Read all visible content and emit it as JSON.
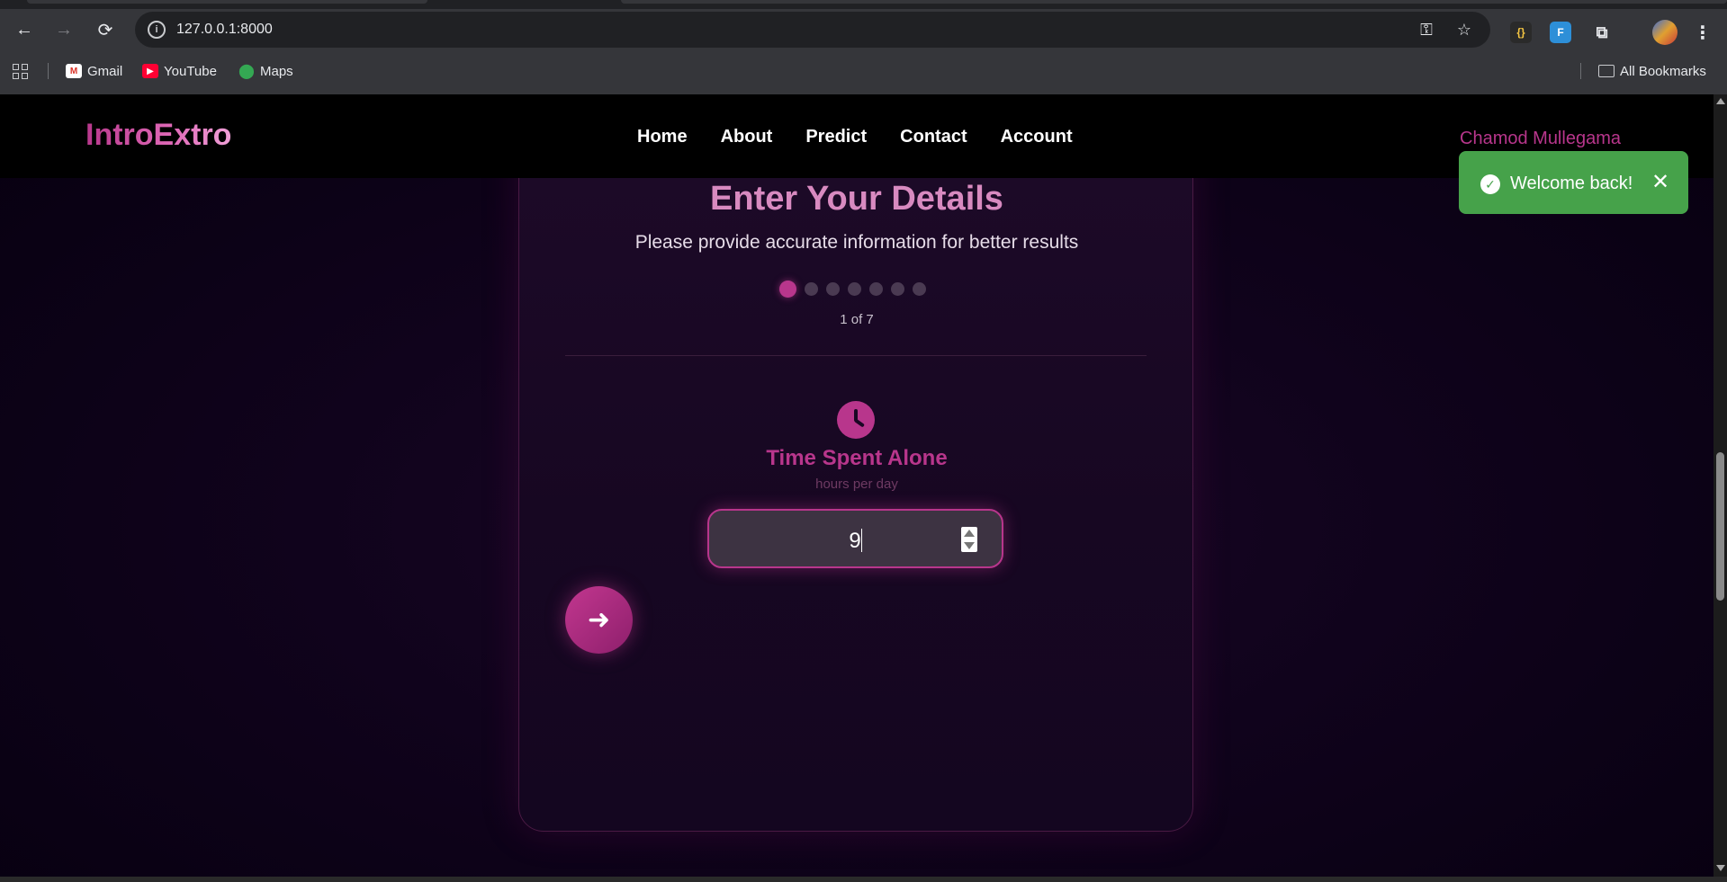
{
  "browser": {
    "url": "127.0.0.1:8000",
    "bookmarks": [
      {
        "label": "Gmail",
        "icon": "gmail-icon"
      },
      {
        "label": "YouTube",
        "icon": "youtube-icon"
      },
      {
        "label": "Maps",
        "icon": "maps-icon"
      }
    ],
    "all_bookmarks_label": "All Bookmarks"
  },
  "site": {
    "logo": "IntroExtro",
    "nav": [
      "Home",
      "About",
      "Predict",
      "Contact",
      "Account"
    ],
    "user_name": "Chamod Mullegama"
  },
  "form": {
    "title": "Enter Your Details",
    "subtitle": "Please provide accurate information for better results",
    "step_text": "1 of 7",
    "total_steps": 7,
    "current_step": 1,
    "field_label": "Time Spent Alone",
    "field_hint": "hours per day",
    "field_value": "9",
    "field_icon": "clock-icon",
    "next_icon": "arrow-right-icon"
  },
  "toast": {
    "message": "Welcome back!",
    "icon": "check-circle-icon",
    "color": "#46a24a"
  },
  "colors": {
    "accent": "#b8368c",
    "background": "#10031c"
  }
}
